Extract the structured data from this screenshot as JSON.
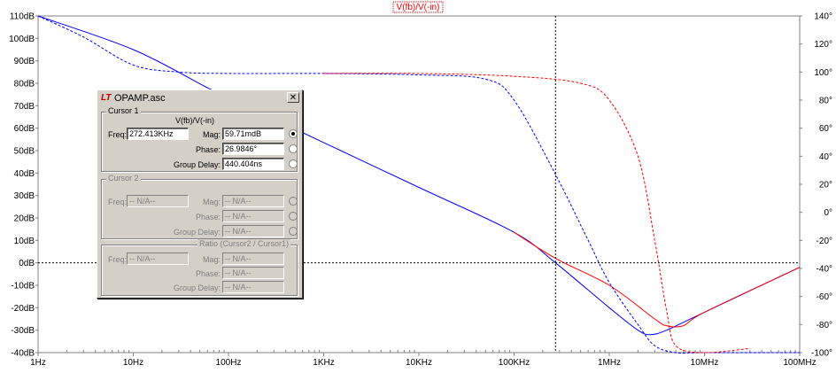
{
  "plot": {
    "title": "V(fb)/V(-in)",
    "left_axis_ticks": [
      "110dB",
      "100dB",
      "90dB",
      "80dB",
      "70dB",
      "60dB",
      "50dB",
      "40dB",
      "30dB",
      "20dB",
      "10dB",
      "0dB",
      "-10dB",
      "-20dB",
      "-30dB",
      "-40dB"
    ],
    "right_axis_ticks": [
      "140°",
      "120°",
      "100°",
      "80°",
      "60°",
      "40°",
      "20°",
      "0°",
      "-20°",
      "-40°",
      "-60°",
      "-80°",
      "-100°"
    ],
    "x_axis_ticks": [
      "1Hz",
      "10Hz",
      "100Hz",
      "1KHz",
      "10KHz",
      "100KHz",
      "1MHz",
      "10MHz",
      "100MHz"
    ],
    "colors": {
      "blue": "#0000ff",
      "red": "#ff0000",
      "cursor": "#000000"
    }
  },
  "chart_data": {
    "type": "line",
    "xscale": "log",
    "xlim": [
      1,
      100000000
    ],
    "ylim_left": [
      -40,
      110
    ],
    "ylim_right": [
      -100,
      140
    ],
    "cursor": {
      "x": 272413,
      "y": 0
    },
    "series": [
      {
        "color": "blue",
        "style": "solid",
        "axis": "left",
        "x": [
          1,
          10,
          60,
          100,
          1000,
          10000,
          100000,
          272413,
          1000000,
          2000000,
          2700000,
          4000000,
          10000000,
          100000000
        ],
        "y": [
          110,
          95,
          78,
          73.6,
          53.6,
          33.6,
          13.6,
          0,
          -20,
          -30,
          -32,
          -30,
          -22,
          -2
        ]
      },
      {
        "color": "red",
        "style": "solid",
        "axis": "left",
        "x": [
          100000,
          272413,
          1000000,
          3000000,
          4000000,
          6000000,
          10000000,
          100000000
        ],
        "y": [
          13.6,
          2,
          -10,
          -25,
          -28,
          -28,
          -22,
          -2
        ]
      },
      {
        "color": "blue",
        "style": "dashed",
        "axis": "right",
        "x": [
          1,
          3,
          10,
          30,
          100,
          1000,
          10000,
          50000,
          100000,
          272413,
          600000,
          1000000,
          2000000,
          3000000,
          5000000,
          10000000,
          100000000
        ],
        "y": [
          140,
          125,
          105,
          100,
          99,
          99,
          98,
          95,
          80,
          27,
          -20,
          -50,
          -80,
          -95,
          -100,
          -100,
          -100
        ]
      },
      {
        "color": "red",
        "style": "dashed",
        "axis": "right",
        "x": [
          1000,
          10000,
          100000,
          500000,
          1000000,
          2000000,
          3000000,
          4000000,
          5000000,
          10000000,
          30000000
        ],
        "y": [
          99,
          99,
          97,
          92,
          80,
          40,
          -20,
          -70,
          -95,
          -100,
          -97
        ]
      }
    ]
  },
  "dialog": {
    "title": "OPAMP.asc",
    "close_label": "✕",
    "cursor1": {
      "legend": "Cursor 1",
      "expr": "V(fb)/V(-in)",
      "freq_label": "Freq:",
      "freq": "272.413KHz",
      "mag_label": "Mag:",
      "mag": "59.71mdB",
      "phase_label": "Phase:",
      "phase": "26.9846°",
      "gd_label": "Group Delay:",
      "gd": "440.404ns"
    },
    "cursor2": {
      "legend": "Cursor 2",
      "freq_label": "Freq:",
      "freq": "-- N/A--",
      "mag_label": "Mag:",
      "mag": "-- N/A--",
      "phase_label": "Phase:",
      "phase": "-- N/A--",
      "gd_label": "Group Delay:",
      "gd": "-- N/A--"
    },
    "ratio": {
      "legend": "Ratio (Cursor2 / Cursor1)",
      "freq_label": "Freq:",
      "freq": "-- N/A--",
      "mag_label": "Mag:",
      "mag": "-- N/A--",
      "phase_label": "Phase:",
      "phase": "-- N/A--",
      "gd_label": "Group Delay:",
      "gd": "-- N/A--"
    }
  }
}
